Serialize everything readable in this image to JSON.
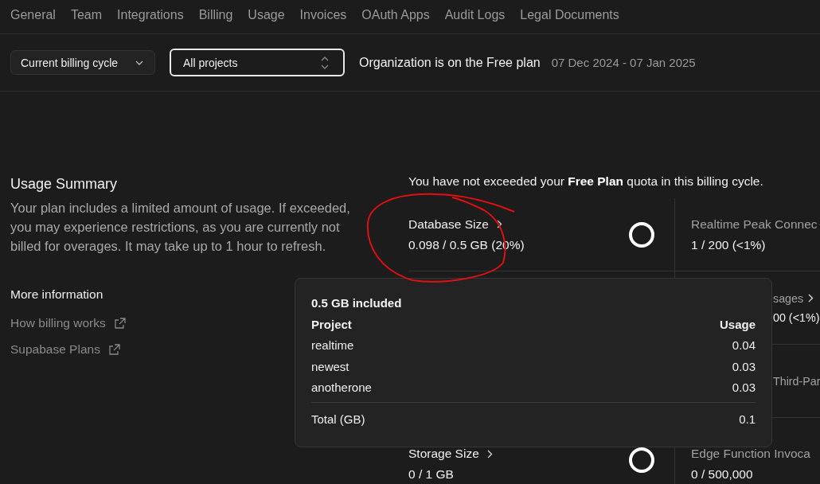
{
  "tabs": [
    {
      "label": "General"
    },
    {
      "label": "Team"
    },
    {
      "label": "Integrations"
    },
    {
      "label": "Billing"
    },
    {
      "label": "Usage"
    },
    {
      "label": "Invoices"
    },
    {
      "label": "OAuth Apps"
    },
    {
      "label": "Audit Logs"
    },
    {
      "label": "Legal Documents"
    }
  ],
  "filters": {
    "period": "Current billing cycle",
    "project": "All projects",
    "plan_note": "Organization is on the Free plan",
    "date_range": "07 Dec 2024 - 07 Jan 2025"
  },
  "summary": {
    "title": "Usage Summary",
    "text": "Your plan includes a limited amount of usage. If exceeded, you may experience restrictions, as you are currently not billed for overages. It may take up to 1 hour to refresh.",
    "more_title": "More information",
    "links": [
      {
        "label": "How billing works"
      },
      {
        "label": "Supabase Plans"
      }
    ]
  },
  "quota_note": "You have not exceeded your **Free Plan** quota in this billing cycle.",
  "metric_rows": [
    {
      "left": {
        "title": "Database Size",
        "value": "0.098 / 0.5 GB (20%)"
      },
      "right": {
        "title": "Realtime Peak Connec",
        "value": "1 / 200 (<1%)"
      }
    },
    {
      "right": {
        "title": "sages",
        "value": "00 (<1%)",
        "chevron": true
      }
    },
    {
      "right": {
        "title": "Third-Par"
      }
    },
    {
      "left": {
        "title": "Storage Size",
        "value": "0 / 1 GB"
      },
      "right": {
        "title": "Edge Function Invoca",
        "value": "0 / 500,000"
      }
    }
  ],
  "tooltip": {
    "title": "0.5 GB included",
    "columns": [
      "Project",
      "Usage"
    ],
    "rows": [
      [
        "realtime",
        "0.04"
      ],
      [
        "newest",
        "0.03"
      ],
      [
        "anotherone",
        "0.03"
      ]
    ],
    "total": [
      "Total (GB)",
      "0.1"
    ]
  }
}
